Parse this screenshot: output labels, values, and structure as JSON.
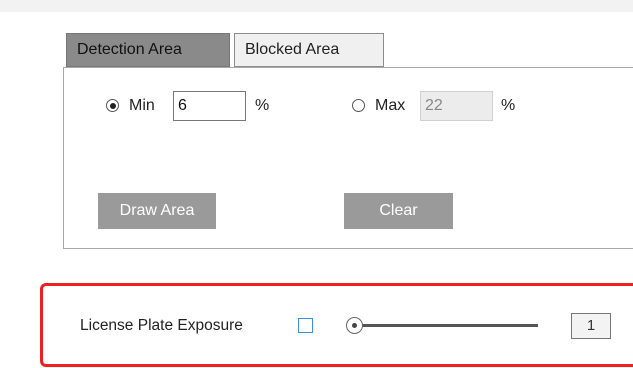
{
  "tabs": [
    {
      "label": "Detection Area",
      "active": true
    },
    {
      "label": "Blocked Area",
      "active": false
    }
  ],
  "min": {
    "label": "Min",
    "value": "6",
    "unit": "%",
    "selected": true
  },
  "max": {
    "label": "Max",
    "value": "22",
    "unit": "%",
    "selected": false
  },
  "buttons": {
    "draw_area": "Draw Area",
    "clear": "Clear"
  },
  "license_plate": {
    "label": "License Plate Exposure",
    "checked": false,
    "slider_level": 1,
    "value": "1"
  },
  "colors": {
    "active_tab": "#8a8a8a",
    "button": "#9a9a9a",
    "highlight_border": "#ee2020",
    "checkbox_border": "#3c8fe0"
  }
}
